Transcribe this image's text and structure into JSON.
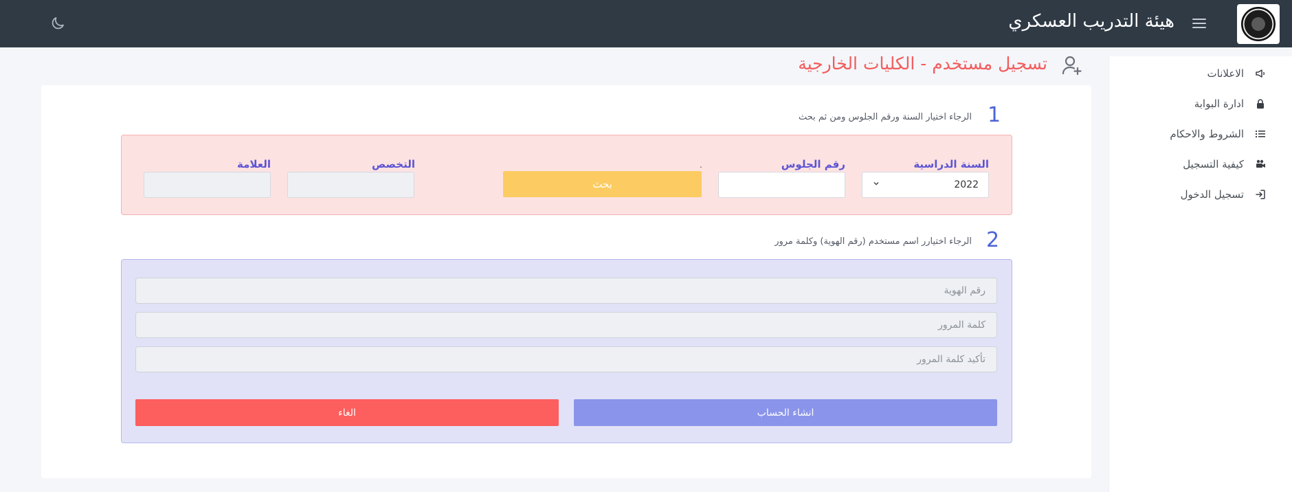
{
  "header": {
    "brand_title": "هيئة التدريب العسكري",
    "icons": {
      "menu": "hamburger-icon",
      "theme": "moon-icon"
    }
  },
  "sidebar": {
    "items": [
      {
        "label": "الاعلانات",
        "icon": "megaphone-icon"
      },
      {
        "label": "ادارة البوابة",
        "icon": "lock-icon"
      },
      {
        "label": "الشروط والاحكام",
        "icon": "list-icon"
      },
      {
        "label": "كيفية التسجيل",
        "icon": "video-camera-icon"
      },
      {
        "label": "تسجيل الدخول",
        "icon": "login-icon"
      }
    ]
  },
  "page": {
    "title": "تسجيل مستخدم - الكليات الخارجية",
    "title_icon": "user-plus-icon"
  },
  "step1": {
    "number": "1",
    "instruction": "الرجاء اختيار السنة ورقم الجلوس ومن ثم بحث",
    "year_label": "السنة الدراسية",
    "year_value": "2022",
    "seat_label": "رقم الجلوس",
    "seat_value": "",
    "dot": ".",
    "search_label": "بحث",
    "specialty_label": "التخصص",
    "grade_label": "العلامة"
  },
  "step2": {
    "number": "2",
    "instruction": "الرجاء اختيارر اسم مستخدم (رقم الهوية) وكلمة مرور",
    "id_placeholder": "رقم الهوية",
    "password_placeholder": "كلمة المرور",
    "confirm_placeholder": "تأكيد كلمة المرور",
    "create_label": "انشاء الحساب",
    "cancel_label": "الغاء"
  },
  "colors": {
    "topbar": "#2f3a45",
    "title_red": "#f25c5c",
    "step_blue": "#4b63d8",
    "label_purple": "#5b54d4",
    "search_yellow": "#fccc62",
    "create_blue": "#8a94ea",
    "cancel_red": "#fd5e5e",
    "box1_bg": "#fde2e2",
    "box2_bg": "#e1e2f7"
  }
}
